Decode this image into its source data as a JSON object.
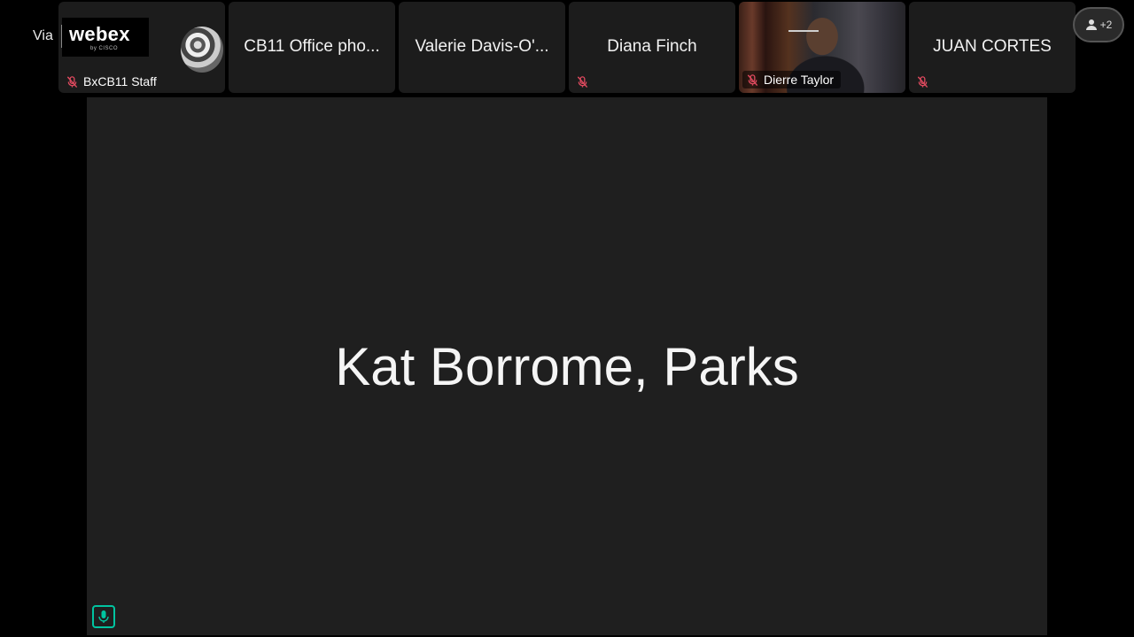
{
  "branding": {
    "via_label": "Via",
    "brand_name": "webex",
    "brand_sub": "by CISCO"
  },
  "participants": [
    {
      "name": "",
      "footer_label": "BxCB11 Staff",
      "muted": true
    },
    {
      "name": "CB11 Office pho...",
      "footer_label": "",
      "muted": false
    },
    {
      "name": "Valerie Davis-O'...",
      "footer_label": "",
      "muted": false
    },
    {
      "name": "Diana Finch",
      "footer_label": "",
      "muted": true
    },
    {
      "name": "",
      "footer_label": "Dierre Taylor",
      "muted": true,
      "video": true
    },
    {
      "name": "JUAN CORTES",
      "footer_label": "",
      "muted": true
    }
  ],
  "overflow": {
    "count_label": "+2"
  },
  "main": {
    "speaker_name": "Kat Borrome, Parks"
  },
  "colors": {
    "background": "#000000",
    "tile": "#1c1c1c",
    "stage": "#1f1f1f",
    "mute_red": "#e04a5f",
    "active_teal": "#00c4a0"
  }
}
